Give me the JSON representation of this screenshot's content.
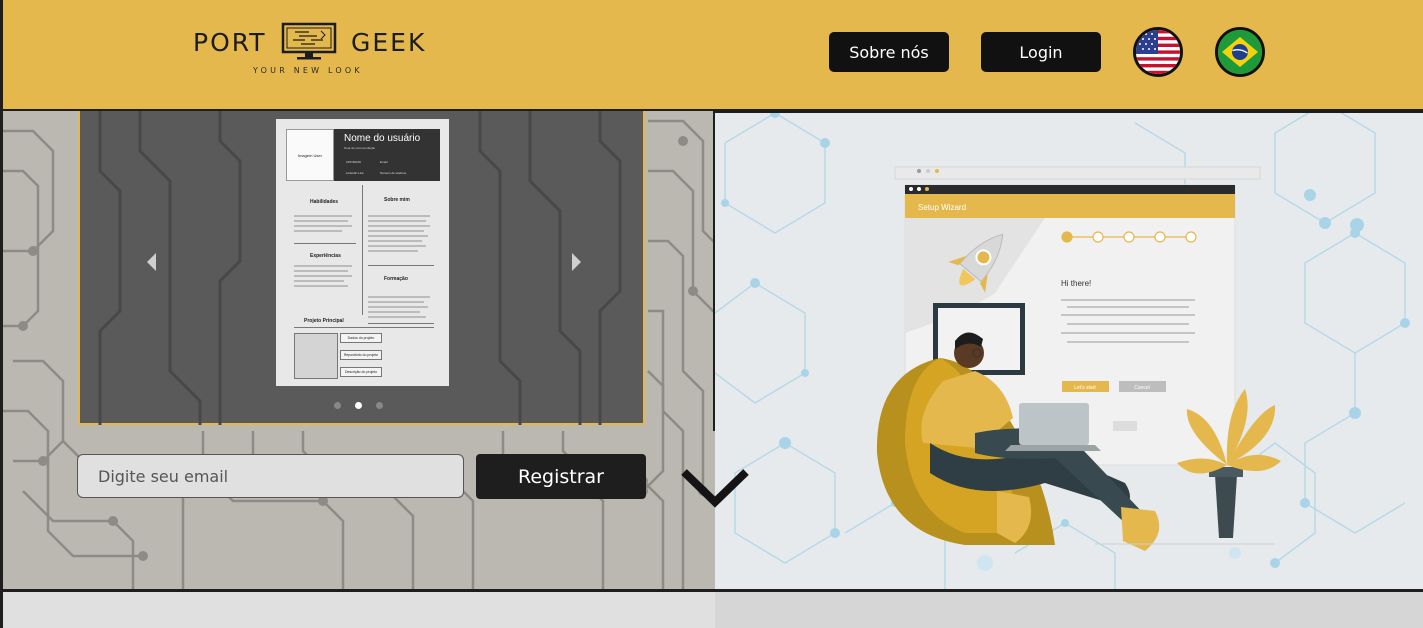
{
  "brand": {
    "left_word": "PORT",
    "right_word": "GEEK",
    "tagline": "YOUR NEW LOOK"
  },
  "nav": {
    "about_label": "Sobre nós",
    "login_label": "Login"
  },
  "languages": [
    "English (US flag)",
    "Português (Brazil flag)"
  ],
  "carousel": {
    "slide_count": 3,
    "active_slide": 2,
    "cv": {
      "photo_label": "Imagem User",
      "name": "Nome do usuário",
      "subtitle": "Nota de recomendação",
      "contacts": [
        "CPF/RG/NI",
        "Email",
        "LinkedIn Link",
        "Número de telefone"
      ],
      "sections": {
        "skills": "Habilidades",
        "about": "Sobre mim",
        "experience": "Experiências",
        "education": "Formação",
        "project": "Projeto Principal"
      },
      "project_buttons": [
        "Dados do projeto",
        "Repositório do projeto",
        "Descrição do projeto"
      ]
    }
  },
  "signup": {
    "email_placeholder": "Digite seu email",
    "register_label": "Registrar"
  },
  "illustration": {
    "wizard_title": "Setup Wizard",
    "greeting": "Hi there!",
    "primary_btn": "Let's start",
    "secondary_btn": "Cancel"
  },
  "colors": {
    "brand_yellow": "#e5b84e",
    "dark": "#111111",
    "hero_gray": "#bbb8b2",
    "network_blue": "#9ccbe0"
  }
}
